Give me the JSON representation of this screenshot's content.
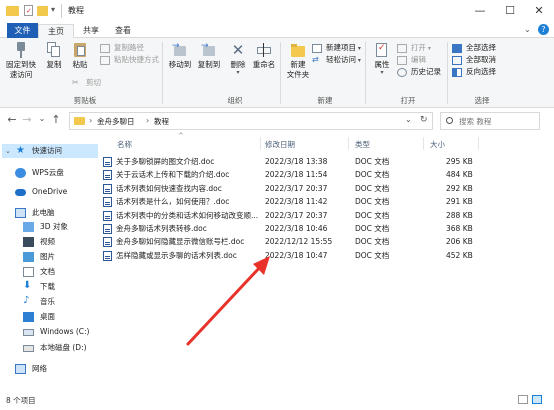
{
  "window": {
    "title": "教程",
    "minimize": "—",
    "maximize": "☐",
    "close": "✕"
  },
  "tabs": [
    {
      "label": "文件"
    },
    {
      "label": "主页"
    },
    {
      "label": "共享"
    },
    {
      "label": "查看"
    }
  ],
  "ribbon": {
    "clipboard": {
      "pin_label_1": "固定到快",
      "pin_label_2": "速访问",
      "copy": "复制",
      "paste": "粘贴",
      "copy_path": "复制路径",
      "paste_shortcut": "粘贴快捷方式",
      "cut": "剪切",
      "group": "剪贴板"
    },
    "organize": {
      "move_1": "移动到",
      "copy_1": "复制到",
      "delete": "删除",
      "rename": "重命名",
      "group": "组织"
    },
    "new": {
      "new_folder_1": "新建",
      "new_folder_2": "文件夹",
      "new_item": "新建项目",
      "easy_access": "轻松访问",
      "group": "新建"
    },
    "open": {
      "properties": "属性",
      "open": "打开",
      "edit": "编辑",
      "history": "历史记录",
      "group": "打开"
    },
    "select": {
      "select_all": "全部选择",
      "select_none": "全部取消",
      "invert": "反向选择",
      "group": "选择"
    }
  },
  "nav": {
    "back": "←",
    "forward": "→",
    "down": "⌄",
    "up": "↑",
    "crumb_1": "金舟多聊日",
    "crumb_sep": "›",
    "crumb_2": "教程",
    "refresh": "↻",
    "search_placeholder": "搜索 教程"
  },
  "sidebar": {
    "items": [
      {
        "label": "快速访问",
        "icon": "star-icon"
      },
      {
        "label": "WPS云盘",
        "icon": "cloud-icon"
      },
      {
        "label": "OneDrive",
        "icon": "onedrive-icon"
      },
      {
        "label": "此电脑",
        "icon": "computer-icon"
      },
      {
        "label": "3D 对象",
        "icon": "3d-icon"
      },
      {
        "label": "视频",
        "icon": "video-icon"
      },
      {
        "label": "图片",
        "icon": "picture-icon"
      },
      {
        "label": "文档",
        "icon": "document-icon"
      },
      {
        "label": "下载",
        "icon": "download-icon"
      },
      {
        "label": "音乐",
        "icon": "music-icon"
      },
      {
        "label": "桌面",
        "icon": "desktop-icon"
      },
      {
        "label": "Windows (C:)",
        "icon": "drive-icon"
      },
      {
        "label": "本地磁盘 (D:)",
        "icon": "drive-icon"
      },
      {
        "label": "网络",
        "icon": "network-icon"
      }
    ]
  },
  "columns": {
    "name": "名称",
    "sort_indicator": "^",
    "date": "修改日期",
    "type": "类型",
    "size": "大小"
  },
  "files": [
    {
      "name": "关于多聊锁屏的图文介绍.doc",
      "date": "2022/3/18 13:38",
      "type": "DOC 文档",
      "size": "295 KB"
    },
    {
      "name": "关于云话术上传和下载的介绍.doc",
      "date": "2022/3/18 11:54",
      "type": "DOC 文档",
      "size": "484 KB"
    },
    {
      "name": "话术列表如何快速查找内容.doc",
      "date": "2022/3/17 20:37",
      "type": "DOC 文档",
      "size": "292 KB"
    },
    {
      "name": "话术列表是什么，如何使用？.doc",
      "date": "2022/3/18 11:42",
      "type": "DOC 文档",
      "size": "291 KB"
    },
    {
      "name": "话术列表中的分类和话术如何移动改变顺...",
      "date": "2022/3/17 20:37",
      "type": "DOC 文档",
      "size": "288 KB"
    },
    {
      "name": "金舟多聊话术列表转移.doc",
      "date": "2022/3/18 10:46",
      "type": "DOC 文档",
      "size": "368 KB"
    },
    {
      "name": "金舟多聊如何隐藏显示微信账号栏.doc",
      "date": "2022/12/12 15:55",
      "type": "DOC 文档",
      "size": "206 KB"
    },
    {
      "name": "怎样隐藏或显示多聊的话术列表.doc",
      "date": "2022/3/18 10:47",
      "type": "DOC 文档",
      "size": "452 KB"
    }
  ],
  "status": {
    "count": "8 个项目"
  },
  "colors": {
    "accent": "#1f5fb5",
    "selection": "#cce8ff",
    "arrow": "#e8322a",
    "folder": "#f2c94c"
  }
}
